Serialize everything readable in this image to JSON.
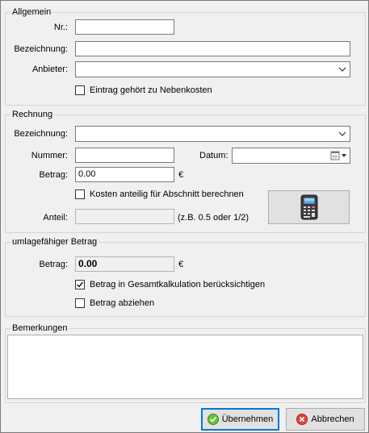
{
  "allgemein": {
    "title": "Allgemein",
    "nr_label": "Nr.:",
    "nr_value": "",
    "bezeichnung_label": "Bezeichnung:",
    "bezeichnung_value": "",
    "anbieter_label": "Anbieter:",
    "anbieter_value": "",
    "nebenkosten_label": "Eintrag gehört zu Nebenkosten",
    "nebenkosten_checked": false
  },
  "rechnung": {
    "title": "Rechnung",
    "bezeichnung_label": "Bezeichnung:",
    "bezeichnung_value": "",
    "nummer_label": "Nummer:",
    "nummer_value": "",
    "datum_label": "Datum:",
    "datum_value": "",
    "betrag_label": "Betrag:",
    "betrag_value": "0.00",
    "currency": "€",
    "anteilig_label": "Kosten anteilig für Abschnitt berechnen",
    "anteilig_checked": false,
    "anteil_label": "Anteil:",
    "anteil_value": "",
    "anteil_hint": "(z.B. 0.5 oder 1/2)",
    "calculator_icon": "calculator-icon"
  },
  "umlage": {
    "title": "umlagefähiger Betrag",
    "betrag_label": "Betrag:",
    "betrag_value": "0.00",
    "currency": "€",
    "gesamt_label": "Betrag in Gesamtkalkulation berücksichtigen",
    "gesamt_checked": true,
    "abziehen_label": "Betrag abziehen",
    "abziehen_checked": false
  },
  "bemerkungen": {
    "title": "Bemerkungen",
    "value": ""
  },
  "buttons": {
    "ok_label": "Übernehmen",
    "ok_icon": "check-circle-icon",
    "cancel_label": "Abbrechen",
    "cancel_icon": "cancel-circle-icon"
  },
  "colors": {
    "accent": "#0078d7",
    "ok_green": "#6cbf3a",
    "cancel_red": "#e0463b"
  }
}
